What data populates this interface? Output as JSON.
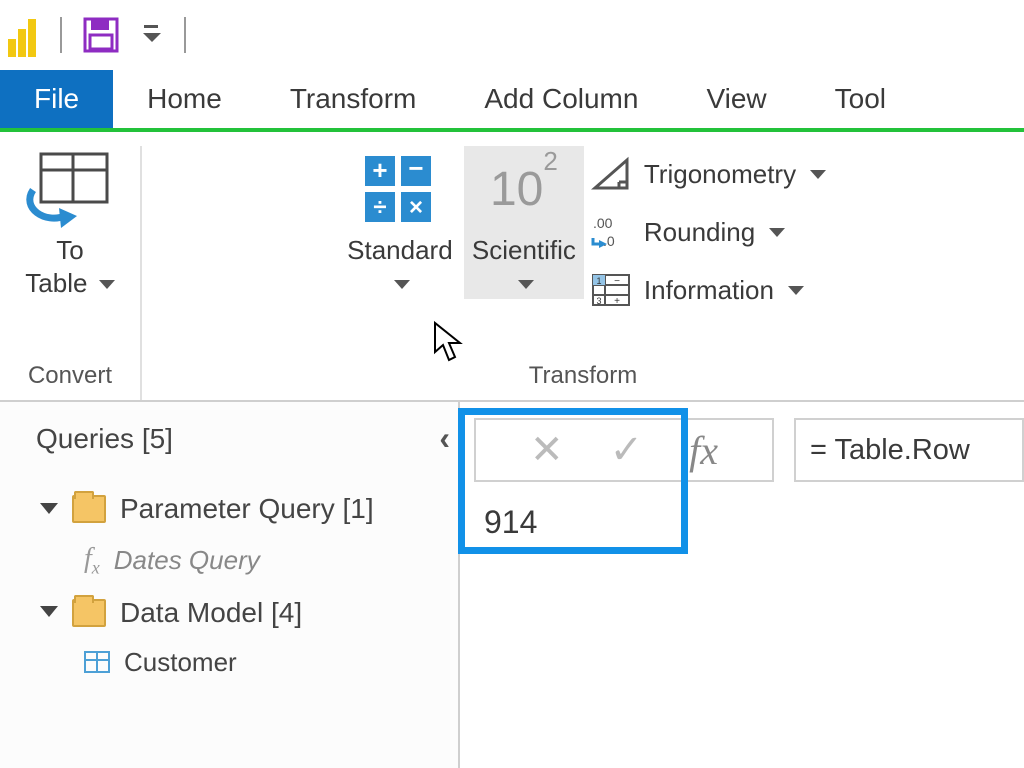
{
  "qat": {
    "save_tooltip": "Save"
  },
  "tabs": {
    "file": "File",
    "home": "Home",
    "transform": "Transform",
    "add_column": "Add Column",
    "view": "View",
    "tools": "Tool"
  },
  "ribbon": {
    "convert": {
      "group_label": "Convert",
      "to_table": "To\nTable"
    },
    "transform": {
      "group_label": "Transform",
      "standard": "Standard",
      "scientific": "Scientific",
      "scientific_icon_text": "10",
      "scientific_icon_sup": "2",
      "trig": "Trigonometry",
      "rounding": "Rounding",
      "information": "Information"
    }
  },
  "queries": {
    "header": "Queries [5]",
    "items": {
      "parameter_group": "Parameter Query [1]",
      "dates_query": "Dates Query",
      "data_model": "Data Model [4]",
      "customer": "Customer"
    }
  },
  "formula_bar": {
    "fx": "fx",
    "text": "= Table.Row"
  },
  "result_value": "914"
}
